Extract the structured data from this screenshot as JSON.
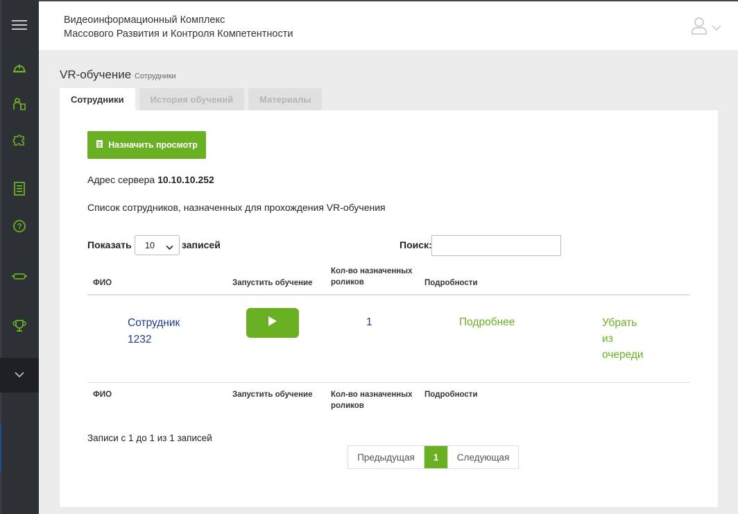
{
  "header": {
    "title_line1": "Видеоинформационный Комплекс",
    "title_line2": "Массового Развития и Контроля Компетентности"
  },
  "sidebar": {
    "items": [
      {
        "icon": "menu-icon"
      },
      {
        "icon": "helmet-icon"
      },
      {
        "icon": "worker-icon"
      },
      {
        "icon": "puzzle-icon"
      },
      {
        "icon": "checklist-icon"
      },
      {
        "icon": "help-icon"
      },
      {
        "icon": "vr-headset-icon"
      },
      {
        "icon": "trophy-icon"
      },
      {
        "icon": "chevron-down-icon"
      }
    ],
    "accent_color": "#6ab023"
  },
  "page": {
    "title": "VR-обучение",
    "subtitle": "Сотрудники"
  },
  "tabs": [
    {
      "label": "Сотрудники",
      "active": true
    },
    {
      "label": "История обучений",
      "active": false
    },
    {
      "label": "Материалы",
      "active": false
    }
  ],
  "panel": {
    "assign_button": "Назначить просмотр",
    "server_label": "Адрес сервера",
    "server_value": "10.10.10.252",
    "list_caption": "Список сотрудников, назначенных для прохождения VR-обучения",
    "show_label": "Показать",
    "page_size": "10",
    "records_label": "записей",
    "search_label": "Поиск:",
    "search_value": ""
  },
  "table": {
    "columns": [
      "ФИО",
      "Запустить обучение",
      "Кол-во назначенных роликов",
      "Подробности"
    ],
    "rows": [
      {
        "name": "Сотрудник 1232",
        "count": "1",
        "details": "Подробнее",
        "remove": "Убрать из очереди"
      }
    ]
  },
  "footer": {
    "info": "Записи с 1 до 1 из 1 записей",
    "prev": "Предыдущая",
    "current_page": "1",
    "next": "Следующая"
  }
}
